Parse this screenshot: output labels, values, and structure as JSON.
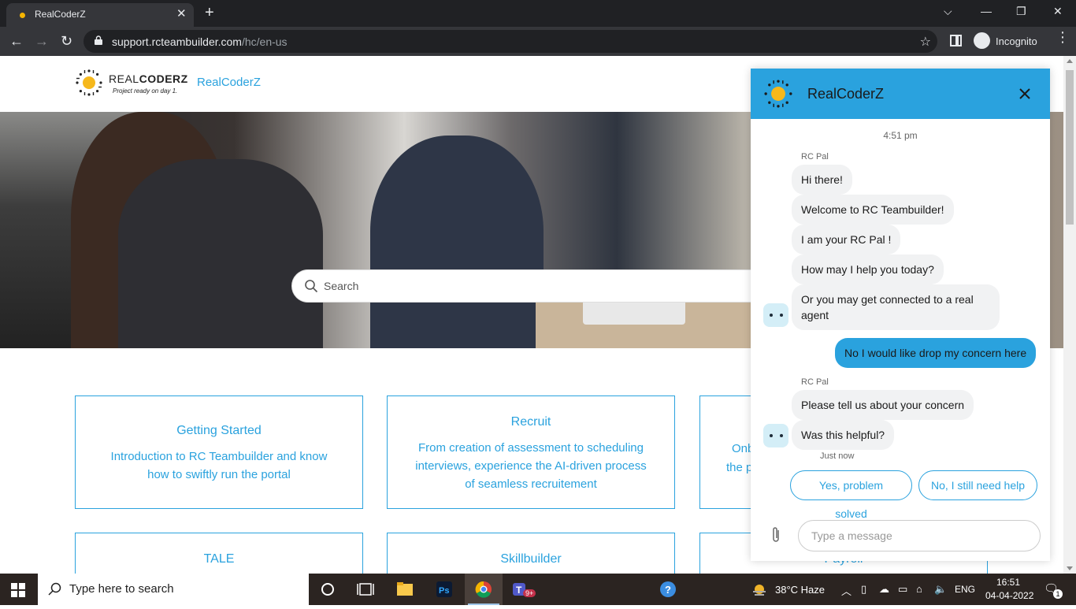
{
  "browser": {
    "tab_title": "RealCoderZ",
    "url_domain": "support.rcteambuilder.com",
    "url_path": "/hc/en-us",
    "profile_label": "Incognito"
  },
  "header": {
    "logo_word_light": "REAL",
    "logo_word_bold": "CODERZ",
    "logo_tagline": "Project ready on day 1.",
    "brand_link": "RealCoderZ"
  },
  "hero": {
    "search_placeholder": "Search"
  },
  "cards": [
    {
      "title": "Getting Started",
      "description": "Introduction to RC Teambuilder and know how to swiftly run the portal"
    },
    {
      "title": "Recruit",
      "description": "From creation of assessment to scheduling interviews, experience the AI-driven process of seamless recruitement"
    },
    {
      "title": "Onb",
      "description": "the p"
    },
    {
      "title": "TALE",
      "description": ""
    },
    {
      "title": "Skillbuilder",
      "description": ""
    },
    {
      "title": "Payroll",
      "description": ""
    }
  ],
  "chat": {
    "title": "RealCoderZ",
    "timestamp": "4:51 pm",
    "sender_name": "RC Pal",
    "messages_1": [
      "Hi there!",
      "Welcome to RC Teambuilder!",
      "I am your RC Pal !",
      "How may I help you today?",
      "Or you may get connected to a real agent"
    ],
    "user_message": "No I would like drop my concern here",
    "messages_2": [
      "Please tell us about your concern",
      "Was this helpful?"
    ],
    "just_now": "Just now",
    "quick_replies": [
      "Yes, problem solved",
      "No, I still need help"
    ],
    "input_placeholder": "Type a message"
  },
  "taskbar": {
    "search_placeholder": "Type here to search",
    "weather": "38°C  Haze",
    "language": "ENG",
    "time": "16:51",
    "date": "04-04-2022",
    "teams_badge": "9+",
    "notification_count": "1"
  },
  "colors": {
    "accent": "#2aa2de",
    "chrome_dark": "#202124",
    "chrome_mid": "#35363a",
    "taskbar": "#2b2421"
  }
}
